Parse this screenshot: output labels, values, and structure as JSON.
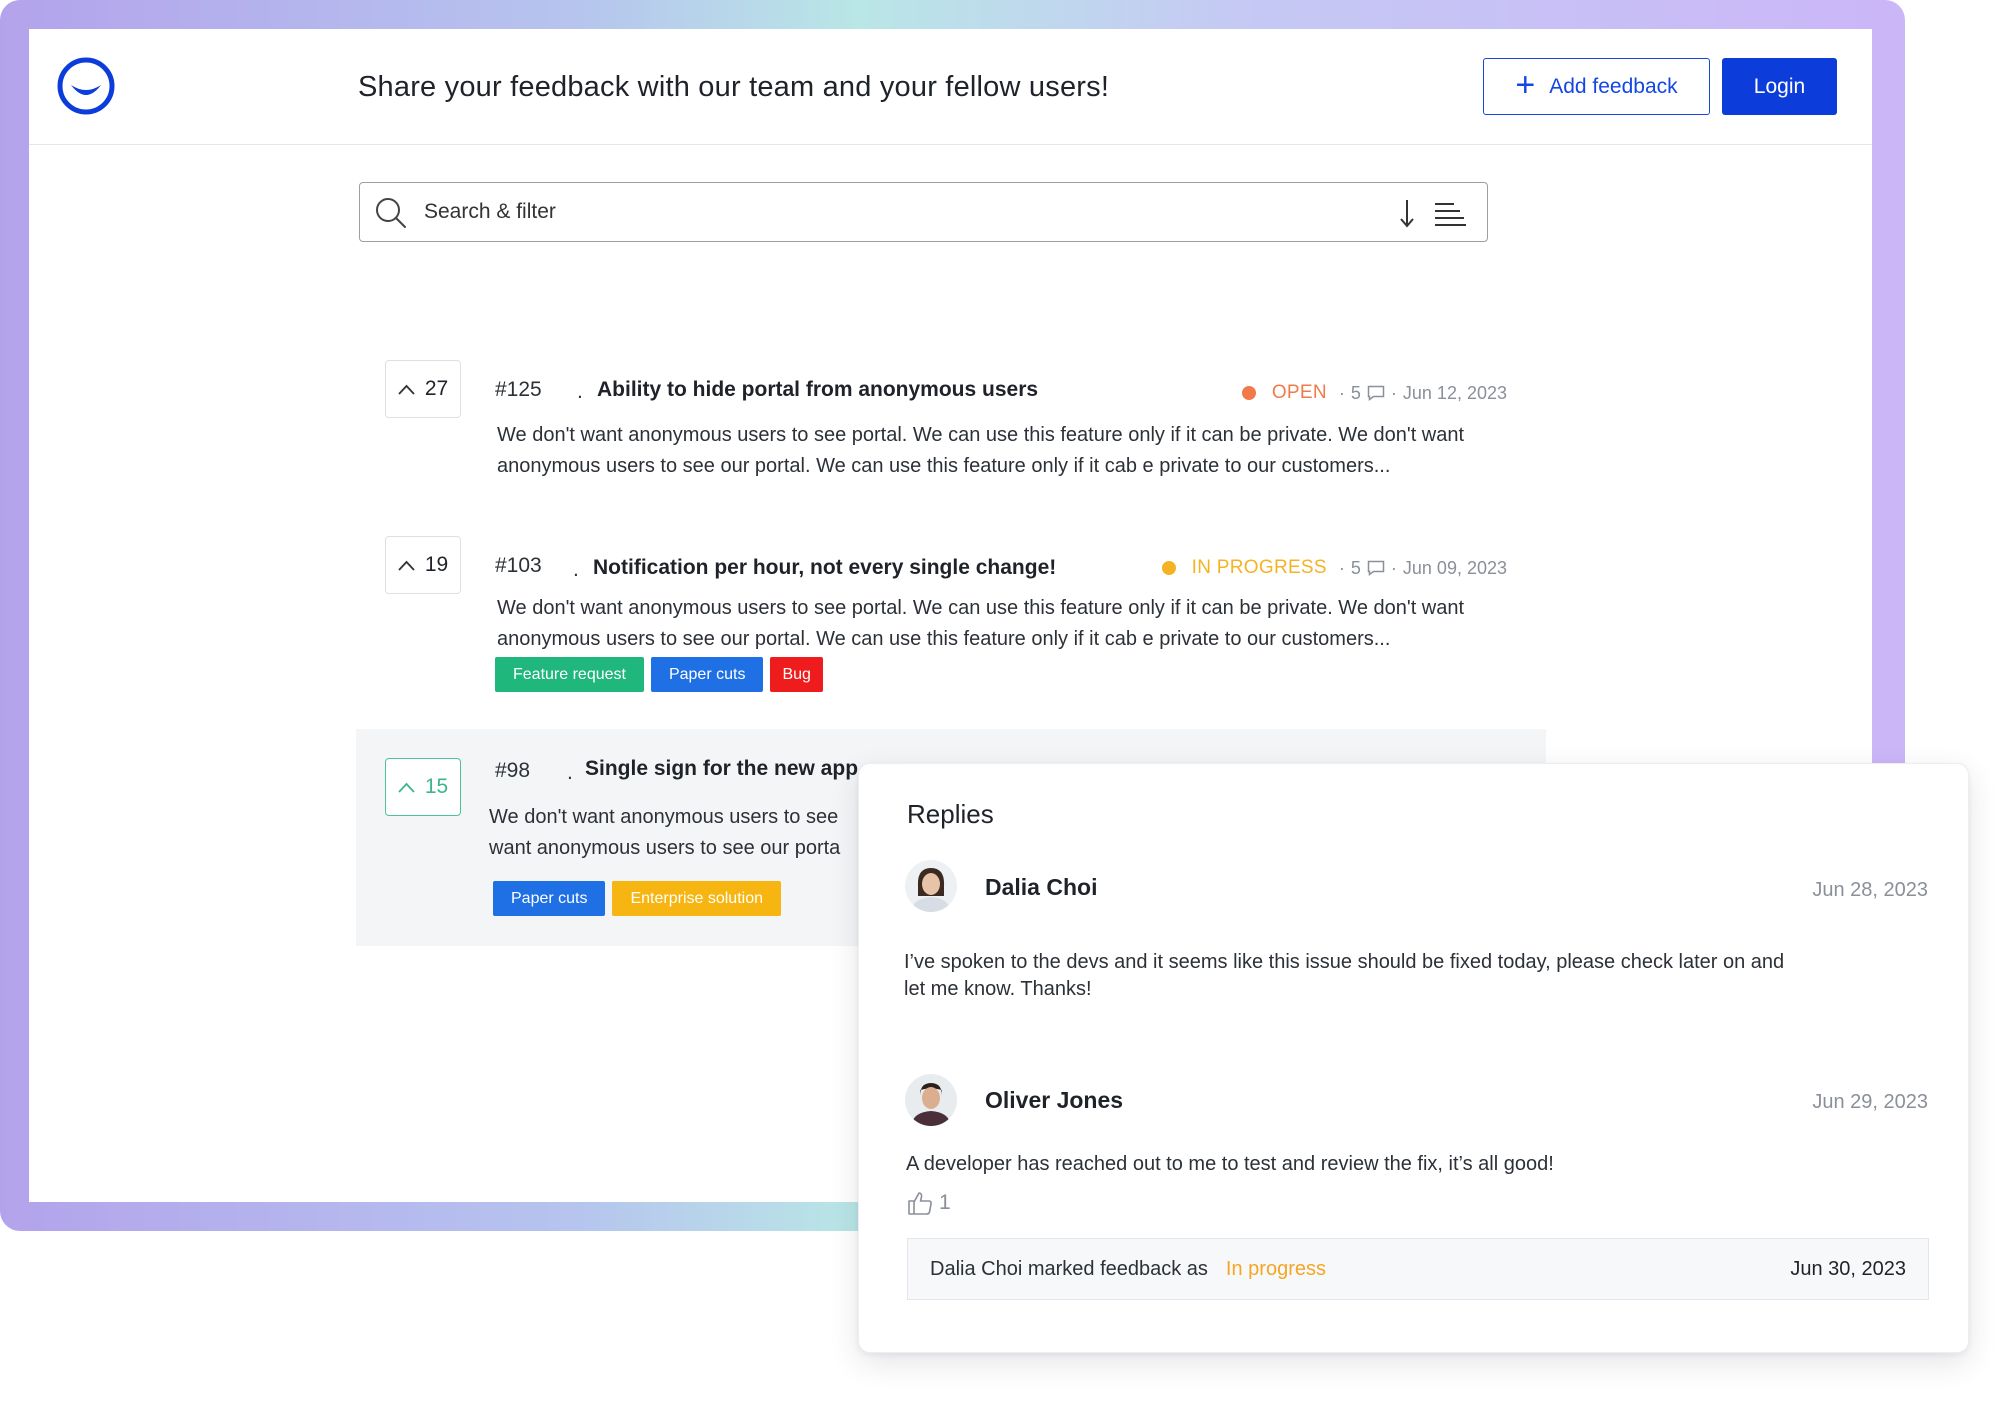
{
  "header": {
    "title": "Share your feedback with our team and your fellow users!",
    "add_feedback_label": "Add feedback",
    "login_label": "Login"
  },
  "search": {
    "placeholder": "Search & filter"
  },
  "feedback_items": [
    {
      "votes": "27",
      "number": "#125",
      "title": "Ability to hide portal from anonymous users",
      "status": "OPEN",
      "status_color": "#f07a4a",
      "comments": "5",
      "date": "Jun 12, 2023",
      "description": "We don't want anonymous users to see portal. We can use this feature only if it can be private. We don't want anonymous users to see our portal. We can use this feature only if it cab e private to our customers...",
      "tags": []
    },
    {
      "votes": "19",
      "number": "#103",
      "title": "Notification per hour, not every single change!",
      "status": "IN PROGRESS",
      "status_color": "#f5b324",
      "comments": "5",
      "date": "Jun 09, 2023",
      "description": "We don't want anonymous users to see portal. We can use this feature only if it can be private. We don't want anonymous users to see our portal. We can use this feature only if it cab e private to our customers...",
      "tags": [
        {
          "label": "Feature request",
          "color": "#1fb77b"
        },
        {
          "label": "Paper cuts",
          "color": "#1f6fe5"
        },
        {
          "label": "Bug",
          "color": "#ee1c1c"
        }
      ]
    },
    {
      "votes": "15",
      "number": "#98",
      "title": "Single sign for the new app",
      "description_line1": "We don't want anonymous users to see",
      "description_line2": "want anonymous users to see our porta",
      "tags": [
        {
          "label": "Paper cuts",
          "color": "#1f6fe5"
        },
        {
          "label": "Enterprise solution",
          "color": "#f7b511"
        }
      ]
    }
  ],
  "replies": {
    "title": "Replies",
    "items": [
      {
        "name": "Dalia Choi",
        "date": "Jun 28, 2023",
        "text": "I’ve spoken to the devs and it seems like this issue should be fixed today, please check later on and let me know. Thanks!"
      },
      {
        "name": "Oliver Jones",
        "date": "Jun 29, 2023",
        "text": "A developer has reached out to me to test and review the fix, it’s all good!",
        "likes": "1"
      }
    ],
    "status_change": {
      "text": "Dalia Choi marked feedback as",
      "status": "In progress",
      "date": "Jun 30, 2023"
    }
  },
  "colors": {
    "brand": "#0c3ddb",
    "open": "#f07a4a",
    "in_progress": "#f5b324",
    "upvote_active": "#3fb58f"
  },
  "icons": [
    "logo-icon",
    "plus-icon",
    "search-icon",
    "sort-icon",
    "filter-icon",
    "chevron-up-icon",
    "comment-icon",
    "thumbs-up-icon"
  ]
}
